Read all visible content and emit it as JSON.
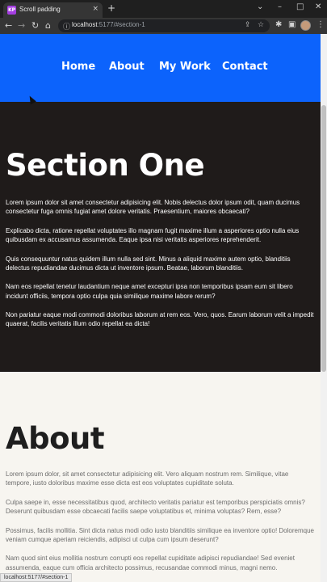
{
  "browser": {
    "tab_title": "Scroll padding",
    "tab_favicon_text": "KP",
    "close_glyph": "×",
    "new_tab_glyph": "+",
    "window": {
      "minimize": "⌄",
      "min2": "–",
      "maximize": "□",
      "close": "✕"
    },
    "url_host": "localhost",
    "url_rest": ":5177/#section-1",
    "status_url": "localhost:5177/#section-1"
  },
  "nav": {
    "items": [
      {
        "label": "Home"
      },
      {
        "label": "About"
      },
      {
        "label": "My Work"
      },
      {
        "label": "Contact"
      }
    ]
  },
  "section_one": {
    "title": "Section One",
    "paragraphs": [
      "Lorem ipsum dolor sit amet consectetur adipisicing elit. Nobis delectus dolor ipsum odit, quam ducimus consectetur fuga omnis fugiat amet dolore veritatis. Praesentium, maiores obcaecati?",
      "Explicabo dicta, ratione repellat voluptates illo magnam fugit maxime illum a asperiores optio nulla eius quibusdam ex accusamus assumenda. Eaque ipsa nisi veritatis asperiores reprehenderit.",
      "Quis consequuntur natus quidem illum nulla sed sint. Minus a aliquid maxime autem optio, blanditiis delectus repudiandae ducimus dicta ut inventore ipsum. Beatae, laborum blanditiis.",
      "Nam eos repellat tenetur laudantium neque amet excepturi ipsa non temporibus ipsam eum sit libero incidunt officiis, tempora optio culpa quia similique maxime labore rerum?",
      "Non pariatur eaque modi commodi doloribus laborum at rem eos. Vero, quos. Earum laborum velit a impedit quaerat, facilis veritatis illum odio repellat ea dicta!"
    ]
  },
  "about": {
    "title": "About",
    "paragraphs": [
      "Lorem ipsum dolor, sit amet consectetur adipisicing elit. Vero aliquam nostrum rem. Similique, vitae tempore, iusto doloribus maxime esse dicta est eos voluptates cupiditate soluta.",
      "Culpa saepe in, esse necessitatibus quod, architecto veritatis pariatur est temporibus perspiciatis omnis? Deserunt quibusdam esse obcaecati facilis saepe voluptatibus et, minima voluptas? Rem, esse?",
      "Possimus, facilis mollitia. Sint dicta natus modi odio iusto blanditiis similique ea inventore optio! Doloremque veniam cumque aperiam reiciendis, adipisci ut culpa cum ipsum deserunt?",
      "Nam quod sint eius mollitia nostrum corrupti eos repellat cupiditate adipisci repudiandae! Sed eveniet assumenda, eaque cum officia architecto possimus, recusandae commodi minus, magni nemo."
    ]
  },
  "colors": {
    "nav_bg": "#0c63fc",
    "section_one_bg": "#1f1b1a",
    "about_bg": "#f7f5f0"
  }
}
